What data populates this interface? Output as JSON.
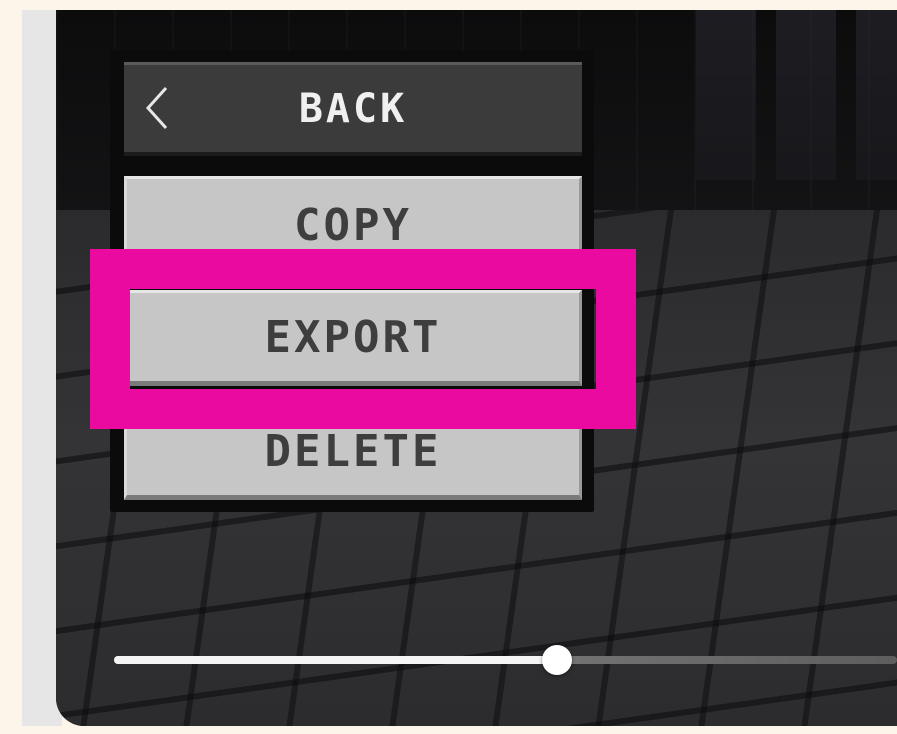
{
  "menu": {
    "back_label": "BACK",
    "copy_label": "COPY",
    "export_label": "EXPORT",
    "delete_label": "DELETE",
    "back_icon": "chevron-left-icon"
  },
  "highlight": {
    "color": "#ea0aa0",
    "target": "export"
  },
  "slider": {
    "value_fraction": 0.566
  }
}
